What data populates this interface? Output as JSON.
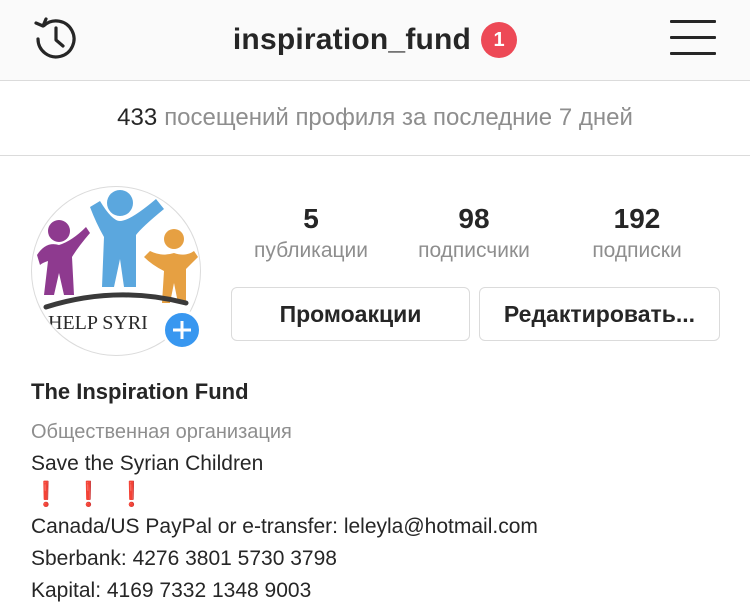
{
  "header": {
    "username": "inspiration_fund",
    "notification_count": "1",
    "history_icon": "history-icon",
    "menu_icon": "hamburger-menu-icon"
  },
  "insights": {
    "count": "433",
    "text": "посещений профиля за последние 7 дней"
  },
  "profile": {
    "avatar_text": "HELP SYRI",
    "stats": [
      {
        "value": "5",
        "label": "публикации"
      },
      {
        "value": "98",
        "label": "подписчики"
      },
      {
        "value": "192",
        "label": "подписки"
      }
    ],
    "buttons": {
      "promotions": "Промоакции",
      "edit": "Редактировать..."
    }
  },
  "bio": {
    "name": "The Inspiration Fund",
    "category": "Общественная организация",
    "lines": [
      "Save the Syrian Children",
      "❗️❗️❗️",
      "Canada/US PayPal or e-transfer: leleyla@hotmail.com",
      "Sberbank: 4276 3801 5730 3798",
      "Kapital: 4169 7332 1348 9003"
    ]
  },
  "colors": {
    "badge": "#ed4956",
    "add_button": "#3897f0",
    "secondary_text": "#8e8e8e",
    "avatar_purple": "#8e3a8f",
    "avatar_blue": "#5ba7de",
    "avatar_orange": "#e6a042"
  }
}
